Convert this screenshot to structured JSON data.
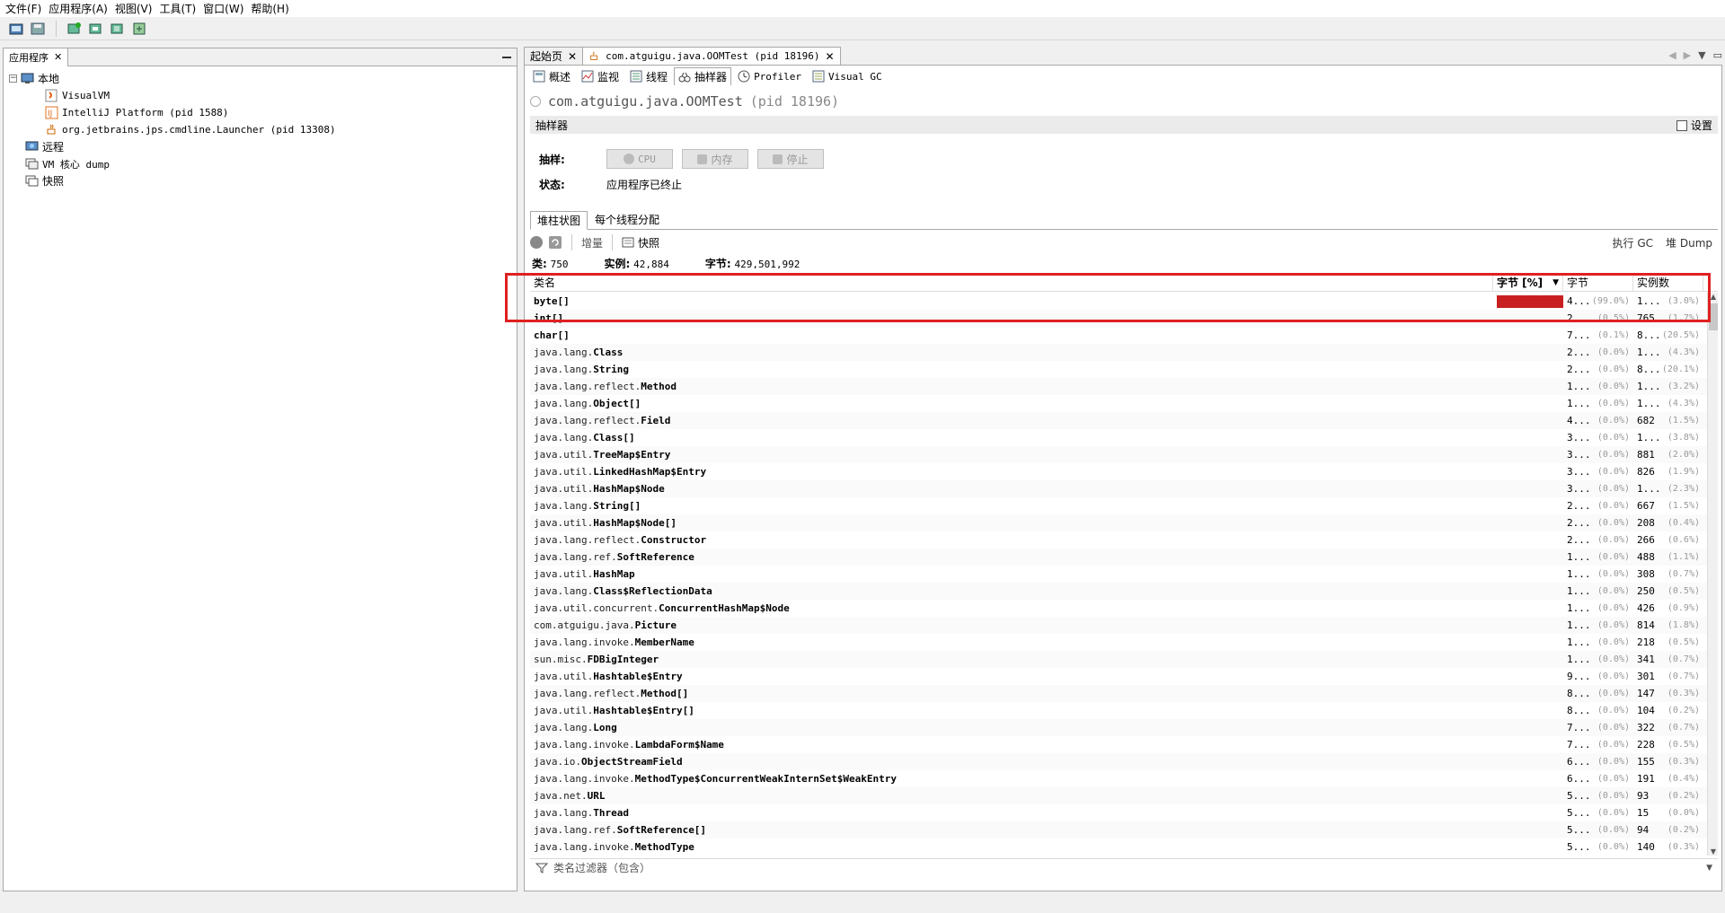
{
  "menu": [
    "文件(F)",
    "应用程序(A)",
    "视图(V)",
    "工具(T)",
    "窗口(W)",
    "帮助(H)"
  ],
  "left_panel": {
    "tab_label": "应用程序",
    "tree": {
      "local": "本地",
      "local_children": [
        "VisualVM",
        "IntelliJ Platform (pid 1588)",
        "org.jetbrains.jps.cmdline.Launcher (pid 13308)"
      ],
      "remote": "远程",
      "vm_core_dump": "VM 核心 dump",
      "snapshots": "快照"
    }
  },
  "doc_tabs": [
    {
      "label": "起始页"
    },
    {
      "label": "com.atguigu.java.OOMTest (pid 18196)"
    }
  ],
  "sub_tabs": [
    "概述",
    "监视",
    "线程",
    "抽样器",
    "Profiler",
    "Visual GC"
  ],
  "app": {
    "title": "com.atguigu.java.OOMTest",
    "pid": "(pid 18196)"
  },
  "sampler": {
    "header": "抽样器",
    "settings_label": "设置",
    "sample_label": "抽样:",
    "status_label": "状态:",
    "status_value": "应用程序已终止",
    "buttons": {
      "cpu": "CPU",
      "memory": "内存",
      "stop": "停止"
    }
  },
  "result_tabs": [
    "堆柱状图",
    "每个线程分配"
  ],
  "result_toolbar": {
    "delta": "增量",
    "snapshot": "快照",
    "gc": "执行 GC",
    "heap_dump": "堆 Dump"
  },
  "stats": {
    "classes_label": "类:",
    "classes_value": "750",
    "instances_label": "实例:",
    "instances_value": "42,884",
    "bytes_label": "字节:",
    "bytes_value": "429,501,992"
  },
  "table": {
    "columns": {
      "name": "类名",
      "bytes_pct": "字节 [%]",
      "bytes": "字节",
      "instances": "实例数"
    },
    "rows": [
      {
        "pkg": "",
        "cls": "byte[]",
        "bytes": "4...",
        "bytes_pct": "(99.0%)",
        "inst": "1...",
        "inst_pct": "(3.0%)"
      },
      {
        "pkg": "",
        "cls": "int[]",
        "bytes": "2...",
        "bytes_pct": "(0.5%)",
        "inst": "765",
        "inst_pct": "(1.7%)"
      },
      {
        "pkg": "",
        "cls": "char[]",
        "bytes": "7...",
        "bytes_pct": "(0.1%)",
        "inst": "8...",
        "inst_pct": "(20.5%)"
      },
      {
        "pkg": "java.lang.",
        "cls": "Class",
        "bytes": "2...",
        "bytes_pct": "(0.0%)",
        "inst": "1...",
        "inst_pct": "(4.3%)"
      },
      {
        "pkg": "java.lang.",
        "cls": "String",
        "bytes": "2...",
        "bytes_pct": "(0.0%)",
        "inst": "8...",
        "inst_pct": "(20.1%)"
      },
      {
        "pkg": "java.lang.reflect.",
        "cls": "Method",
        "bytes": "1...",
        "bytes_pct": "(0.0%)",
        "inst": "1...",
        "inst_pct": "(3.2%)"
      },
      {
        "pkg": "java.lang.",
        "cls": "Object[]",
        "bytes": "1...",
        "bytes_pct": "(0.0%)",
        "inst": "1...",
        "inst_pct": "(4.3%)"
      },
      {
        "pkg": "java.lang.reflect.",
        "cls": "Field",
        "bytes": "4...",
        "bytes_pct": "(0.0%)",
        "inst": "682",
        "inst_pct": "(1.5%)"
      },
      {
        "pkg": "java.lang.",
        "cls": "Class[]",
        "bytes": "3...",
        "bytes_pct": "(0.0%)",
        "inst": "1...",
        "inst_pct": "(3.8%)"
      },
      {
        "pkg": "java.util.",
        "cls": "TreeMap$Entry",
        "bytes": "3...",
        "bytes_pct": "(0.0%)",
        "inst": "881",
        "inst_pct": "(2.0%)"
      },
      {
        "pkg": "java.util.",
        "cls": "LinkedHashMap$Entry",
        "bytes": "3...",
        "bytes_pct": "(0.0%)",
        "inst": "826",
        "inst_pct": "(1.9%)"
      },
      {
        "pkg": "java.util.",
        "cls": "HashMap$Node",
        "bytes": "3...",
        "bytes_pct": "(0.0%)",
        "inst": "1...",
        "inst_pct": "(2.3%)"
      },
      {
        "pkg": "java.lang.",
        "cls": "String[]",
        "bytes": "2...",
        "bytes_pct": "(0.0%)",
        "inst": "667",
        "inst_pct": "(1.5%)"
      },
      {
        "pkg": "java.util.",
        "cls": "HashMap$Node[]",
        "bytes": "2...",
        "bytes_pct": "(0.0%)",
        "inst": "208",
        "inst_pct": "(0.4%)"
      },
      {
        "pkg": "java.lang.reflect.",
        "cls": "Constructor",
        "bytes": "2...",
        "bytes_pct": "(0.0%)",
        "inst": "266",
        "inst_pct": "(0.6%)"
      },
      {
        "pkg": "java.lang.ref.",
        "cls": "SoftReference",
        "bytes": "1...",
        "bytes_pct": "(0.0%)",
        "inst": "488",
        "inst_pct": "(1.1%)"
      },
      {
        "pkg": "java.util.",
        "cls": "HashMap",
        "bytes": "1...",
        "bytes_pct": "(0.0%)",
        "inst": "308",
        "inst_pct": "(0.7%)"
      },
      {
        "pkg": "java.lang.",
        "cls": "Class$ReflectionData",
        "bytes": "1...",
        "bytes_pct": "(0.0%)",
        "inst": "250",
        "inst_pct": "(0.5%)"
      },
      {
        "pkg": "java.util.concurrent.",
        "cls": "ConcurrentHashMap$Node",
        "bytes": "1...",
        "bytes_pct": "(0.0%)",
        "inst": "426",
        "inst_pct": "(0.9%)"
      },
      {
        "pkg": "com.atguigu.java.",
        "cls": "Picture",
        "bytes": "1...",
        "bytes_pct": "(0.0%)",
        "inst": "814",
        "inst_pct": "(1.8%)"
      },
      {
        "pkg": "java.lang.invoke.",
        "cls": "MemberName",
        "bytes": "1...",
        "bytes_pct": "(0.0%)",
        "inst": "218",
        "inst_pct": "(0.5%)"
      },
      {
        "pkg": "sun.misc.",
        "cls": "FDBigInteger",
        "bytes": "1...",
        "bytes_pct": "(0.0%)",
        "inst": "341",
        "inst_pct": "(0.7%)"
      },
      {
        "pkg": "java.util.",
        "cls": "Hashtable$Entry",
        "bytes": "9...",
        "bytes_pct": "(0.0%)",
        "inst": "301",
        "inst_pct": "(0.7%)"
      },
      {
        "pkg": "java.lang.reflect.",
        "cls": "Method[]",
        "bytes": "8...",
        "bytes_pct": "(0.0%)",
        "inst": "147",
        "inst_pct": "(0.3%)"
      },
      {
        "pkg": "java.util.",
        "cls": "Hashtable$Entry[]",
        "bytes": "8...",
        "bytes_pct": "(0.0%)",
        "inst": "104",
        "inst_pct": "(0.2%)"
      },
      {
        "pkg": "java.lang.",
        "cls": "Long",
        "bytes": "7...",
        "bytes_pct": "(0.0%)",
        "inst": "322",
        "inst_pct": "(0.7%)"
      },
      {
        "pkg": "java.lang.invoke.",
        "cls": "LambdaForm$Name",
        "bytes": "7...",
        "bytes_pct": "(0.0%)",
        "inst": "228",
        "inst_pct": "(0.5%)"
      },
      {
        "pkg": "java.io.",
        "cls": "ObjectStreamField",
        "bytes": "6...",
        "bytes_pct": "(0.0%)",
        "inst": "155",
        "inst_pct": "(0.3%)"
      },
      {
        "pkg": "java.lang.invoke.",
        "cls": "MethodType$ConcurrentWeakInternSet$WeakEntry",
        "bytes": "6...",
        "bytes_pct": "(0.0%)",
        "inst": "191",
        "inst_pct": "(0.4%)"
      },
      {
        "pkg": "java.net.",
        "cls": "URL",
        "bytes": "5...",
        "bytes_pct": "(0.0%)",
        "inst": "93",
        "inst_pct": "(0.2%)"
      },
      {
        "pkg": "java.lang.",
        "cls": "Thread",
        "bytes": "5...",
        "bytes_pct": "(0.0%)",
        "inst": "15",
        "inst_pct": "(0.0%)"
      },
      {
        "pkg": "java.lang.ref.",
        "cls": "SoftReference[]",
        "bytes": "5...",
        "bytes_pct": "(0.0%)",
        "inst": "94",
        "inst_pct": "(0.2%)"
      },
      {
        "pkg": "java.lang.invoke.",
        "cls": "MethodType",
        "bytes": "5...",
        "bytes_pct": "(0.0%)",
        "inst": "140",
        "inst_pct": "(0.3%)"
      }
    ]
  },
  "filter_placeholder": "类名过滤器（包含）",
  "colors": {
    "bar": "#c82020",
    "highlight": "#e02020"
  }
}
